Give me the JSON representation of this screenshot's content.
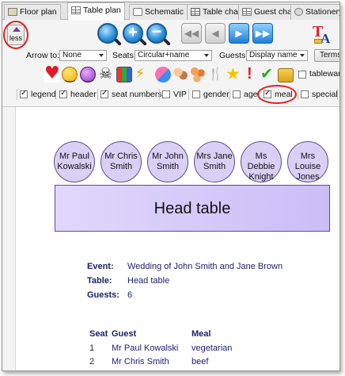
{
  "tabs": [
    {
      "label": "Floor plan",
      "icon": "floor-plan-icon"
    },
    {
      "label": "Table plan",
      "icon": "table-plan-icon",
      "active": true
    },
    {
      "label": "Schematic",
      "icon": "schematic-icon"
    },
    {
      "label": "Table chart",
      "icon": "table-chart-icon"
    },
    {
      "label": "Guest chart",
      "icon": "guest-chart-icon"
    },
    {
      "label": "Stationery",
      "icon": "stationery-icon"
    }
  ],
  "toolbar": {
    "less_label": "less",
    "arrow_to_label": "Arrow to:",
    "arrow_to_value": "None",
    "seats_label": "Seats:",
    "seats_value": "Circular+name",
    "guests_label": "Guests:",
    "guests_value": "Display name",
    "terms_label": "Terms",
    "tableware_label": "tableware"
  },
  "checkboxes": [
    {
      "label": "legend",
      "checked": true
    },
    {
      "label": "header",
      "checked": true
    },
    {
      "label": "seat numbers",
      "checked": true
    },
    {
      "label": "VIP",
      "checked": false
    },
    {
      "label": "gender",
      "checked": false
    },
    {
      "label": "age",
      "checked": false
    },
    {
      "label": "meal",
      "checked": true
    },
    {
      "label": "special",
      "checked": false
    }
  ],
  "seats": [
    {
      "line1": "Mr Paul",
      "line2": "Kowalski"
    },
    {
      "line1": "Mr Chris",
      "line2": "Smith"
    },
    {
      "line1": "Mr John",
      "line2": "Smith"
    },
    {
      "line1": "Mrs Jane",
      "line2": "Smith"
    },
    {
      "line1": "Ms Debbie",
      "line2": "Knight"
    },
    {
      "line1": "Mrs Louise",
      "line2": "Jones"
    }
  ],
  "head_table_label": "Head table",
  "info": {
    "event_label": "Event:",
    "event_value": "Wedding of John Smith and Jane Brown",
    "table_label": "Table:",
    "table_value": "Head table",
    "guests_label": "Guests:",
    "guests_value": "6"
  },
  "guest_table": {
    "headers": {
      "seat": "Seat",
      "guest": "Guest",
      "meal": "Meal"
    },
    "rows": [
      {
        "seat": "1",
        "guest": "Mr Paul Kowalski",
        "meal": "vegetarian"
      },
      {
        "seat": "2",
        "guest": "Mr Chris Smith",
        "meal": "beef"
      }
    ]
  },
  "colors": {
    "seat_fill": "#d8d0f5",
    "seat_border": "#5b4f8a",
    "table_fill": "#cbbdf7",
    "text_navy": "#1d1d6b",
    "highlight_ring": "#e0201c"
  }
}
